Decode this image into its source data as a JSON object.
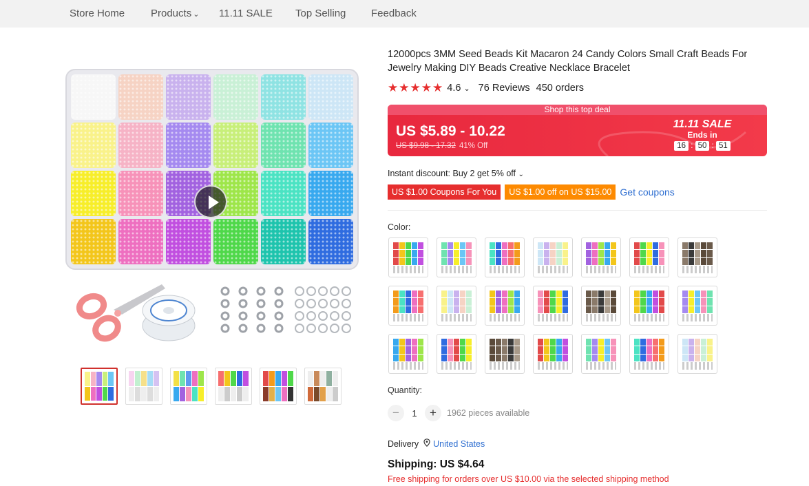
{
  "nav": {
    "items": [
      "Store Home",
      "Products",
      "11.11 SALE",
      "Top Selling",
      "Feedback"
    ],
    "products_chevron": "chevron-down-icon"
  },
  "product": {
    "title": "12000pcs 3MM Seed Beads Kit Macaron 24 Candy Colors Small Craft Beads For Jewelry Making DIY Beads Creative Necklace Bracelet",
    "rating": "4.6",
    "rating_stars": 5,
    "reviews": "76 Reviews",
    "orders": "450 orders"
  },
  "deal": {
    "header": "Shop this top deal",
    "price": "US $5.89 - 10.22",
    "old_price": "US $9.98 - 17.32",
    "discount": "41% Off",
    "sale_title": "11.11 SALE",
    "ends_in": "Ends in",
    "timer": {
      "h": "16",
      "m": "50",
      "s": "51",
      "sep": ":"
    }
  },
  "instant_discount": "Instant discount: Buy 2 get 5% off",
  "coupons": {
    "c1": "US $1.00 Coupons For You",
    "c2": "US $1.00 off on US $15.00",
    "get": "Get coupons"
  },
  "color_label": "Color:",
  "quantity": {
    "label": "Quantity:",
    "minus": "−",
    "plus": "+",
    "value": "1",
    "available": "1962 pieces available"
  },
  "delivery": {
    "label": "Delivery",
    "country": "United States"
  },
  "shipping": {
    "price": "Shipping: US $4.64",
    "free_note": "Free shipping for orders over US $10.00 via the selected shipping method"
  },
  "colors": {
    "accent": "#e62e2e",
    "coupon_orange": "#fd8a01",
    "link": "#2f6fd1"
  }
}
